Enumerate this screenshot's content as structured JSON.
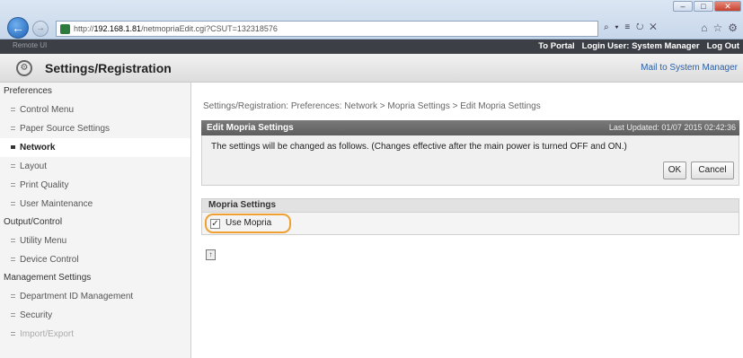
{
  "browser": {
    "url_prefix": "http://",
    "url_host": "192.168.1.81",
    "url_path": "/netmopriaEdit.cgi?CSUT=132318576",
    "addr_tools": "⌕ ▾ ≡ ↻ ✕",
    "icons": [
      "home-icon",
      "star-icon",
      "gear-icon"
    ]
  },
  "app": {
    "device_name": "Remote UI",
    "to_portal": "To Portal",
    "login_user": "Login User: System Manager",
    "log_out": "Log Out",
    "title": "Settings/Registration",
    "mail_to": "Mail to System Manager"
  },
  "sidebar": {
    "sections": [
      {
        "label": "Preferences",
        "items": [
          {
            "label": "Control Menu"
          },
          {
            "label": "Paper Source Settings"
          },
          {
            "label": "Network",
            "active": true
          },
          {
            "label": "Layout"
          },
          {
            "label": "Print Quality"
          },
          {
            "label": "User Maintenance"
          }
        ]
      },
      {
        "label": "Output/Control",
        "items": [
          {
            "label": "Utility Menu"
          },
          {
            "label": "Device Control"
          }
        ]
      },
      {
        "label": "Management Settings",
        "items": [
          {
            "label": "Department ID Management"
          },
          {
            "label": "Security"
          },
          {
            "label": "Import/Export"
          }
        ]
      }
    ]
  },
  "main": {
    "breadcrumb": "Settings/Registration: Preferences: Network > Mopria Settings > Edit Mopria Settings",
    "panel_title": "Edit Mopria Settings",
    "last_updated": "Last Updated: 01/07 2015 02:42:36",
    "message": "The settings will be changed as follows. (Changes effective after the main power is turned OFF and ON.)",
    "ok_label": "OK",
    "cancel_label": "Cancel",
    "section_title": "Mopria Settings",
    "use_mopria_label": "Use Mopria",
    "use_mopria_checked": true,
    "checkbox_mark": "✓",
    "top_icon_glyph": "↑"
  },
  "colors": {
    "highlight": "#f0a030",
    "header_dark": "#3c4046",
    "link": "#2a5fa8"
  }
}
